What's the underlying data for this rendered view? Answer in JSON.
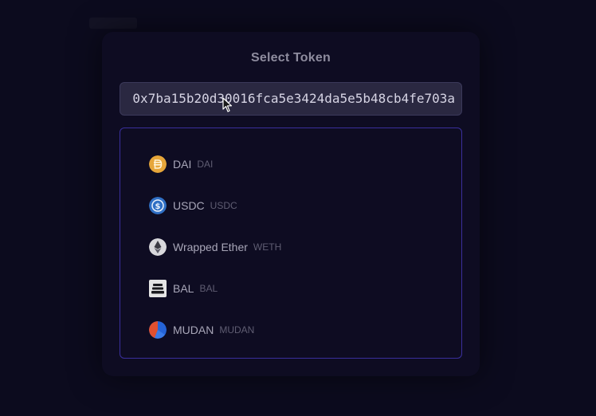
{
  "modal": {
    "title": "Select Token"
  },
  "search": {
    "value": "0x7ba15b20d30016fca5e3424da5e5b48cb4fe703a"
  },
  "tokens": [
    {
      "name": "DAI",
      "symbol": "DAI",
      "icon": "dai-icon",
      "color": "#e6a63a"
    },
    {
      "name": "USDC",
      "symbol": "USDC",
      "icon": "usdc-icon",
      "color": "#2f6fc4"
    },
    {
      "name": "Wrapped Ether",
      "symbol": "WETH",
      "icon": "weth-icon",
      "color": "#d8d8dc"
    },
    {
      "name": "BAL",
      "symbol": "BAL",
      "icon": "bal-icon",
      "color": "#e5e5e5"
    },
    {
      "name": "MUDAN",
      "symbol": "MUDAN",
      "icon": "mudan-icon",
      "color": "#e0502f"
    }
  ]
}
